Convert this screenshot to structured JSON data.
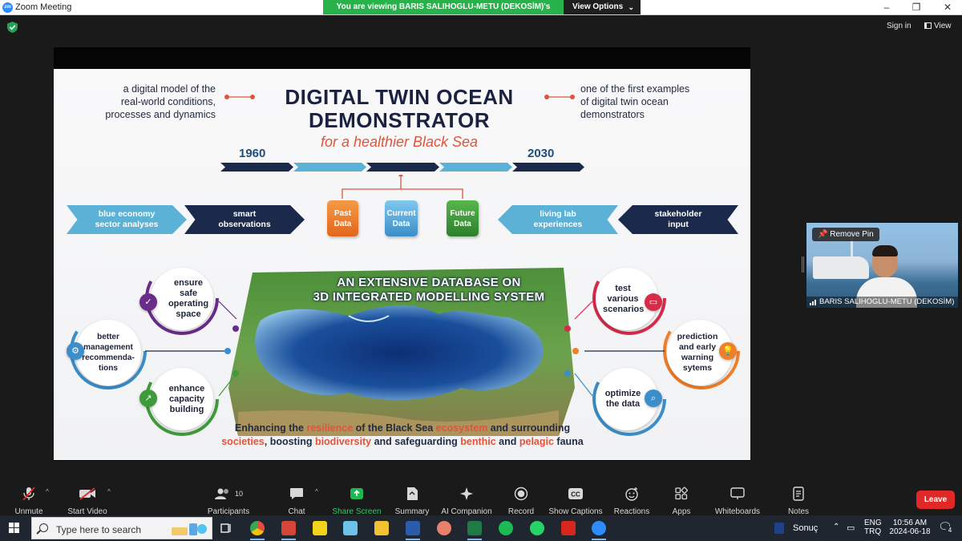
{
  "window": {
    "title": "Zoom Meeting",
    "logo_text": "zm",
    "viewing_banner": "You are viewing BARIS SALIHOGLU-METU (DEKOSİM)'s screen",
    "view_options": "View Options",
    "controls": [
      "–",
      "❐",
      "✕"
    ]
  },
  "topbar": {
    "sign_in": "Sign in",
    "view": "View"
  },
  "slide": {
    "left_note": [
      "a digital model of the",
      "real-world conditions,",
      "processes and dynamics"
    ],
    "right_note": [
      "one of the first examples",
      "of digital twin ocean",
      "demonstrators"
    ],
    "title_line1": "DIGITAL TWIN OCEAN",
    "title_line2": "DEMONSTRATOR",
    "subtitle": "for a healthier Black Sea",
    "year_start": "1960",
    "year_end": "2030",
    "chevrons_left": [
      "blue economy sector analyses",
      "smart observations"
    ],
    "chevrons_right": [
      "living lab experiences",
      "stakeholder input"
    ],
    "data_boxes": [
      "Past Data",
      "Current Data",
      "Future Data"
    ],
    "map_title_line1": "AN EXTENSIVE DATABASE ON",
    "map_title_line2": "3D INTEGRATED MODELLING SYSTEM",
    "circles_left": [
      "ensure safe operating space",
      "better management recommenda-tions",
      "enhance capacity building"
    ],
    "circles_right": [
      "test various scenarios",
      "prediction and early warning sytems",
      "optimize the data"
    ],
    "bottom_text": {
      "l1_a": "Enhancing the ",
      "l1_b": "resilience",
      "l1_c": " of the Black Sea ",
      "l1_d": "ecosystem",
      "l1_e": " and surrounding",
      "l2_a": "societies",
      "l2_b": ", boosting ",
      "l2_c": "biodiversity",
      "l2_d": " and safeguarding ",
      "l2_e": "benthic",
      "l2_f": " and ",
      "l2_g": "pelagic",
      "l2_h": " fauna"
    },
    "colors": {
      "navy": "#1b2a4a",
      "light_blue": "#5bb1d6",
      "orange": "#f07f2a",
      "accent_red": "#e0543b",
      "green": "#3f9b3a"
    }
  },
  "participant_video": {
    "remove_pin": "Remove Pin",
    "name": "BARIS SALIHOGLU-METU (DEKOSİM)"
  },
  "toolbar": {
    "unmute": "Unmute",
    "start_video": "Start Video",
    "participants": "Participants",
    "participants_count": "10",
    "chat": "Chat",
    "share_screen": "Share Screen",
    "summary": "Summary",
    "ai_companion": "AI Companion",
    "record": "Record",
    "show_captions": "Show Captions",
    "reactions": "Reactions",
    "apps": "Apps",
    "whiteboards": "Whiteboards",
    "notes": "Notes",
    "leave": "Leave"
  },
  "taskbar": {
    "search_placeholder": "Type here to search",
    "weather": "Sonuç",
    "lang1": "ENG",
    "lang2": "TRQ",
    "time": "10:56 AM",
    "date": "2024-06-18",
    "notification_count": "4"
  }
}
